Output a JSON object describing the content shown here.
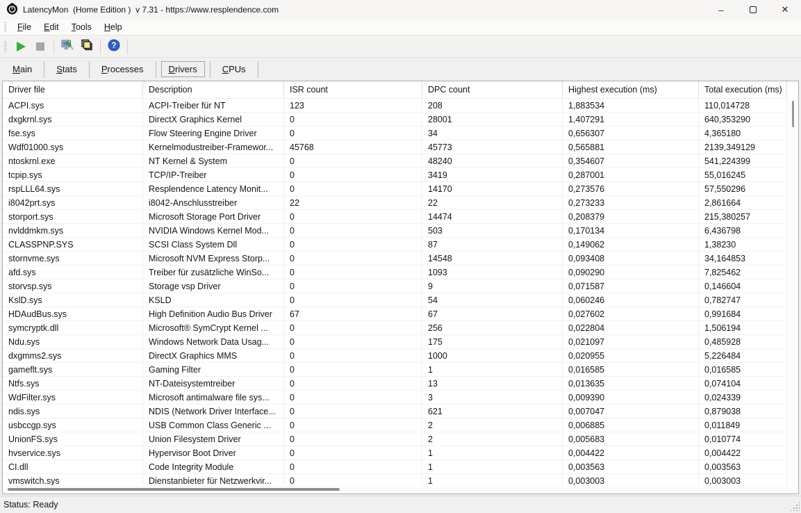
{
  "window": {
    "title": "LatencyMon  (Home Edition )  v 7.31 - https://www.resplendence.com",
    "app_icon": "stopwatch-logo-icon",
    "controls": {
      "minimize_glyph": "–",
      "maximize": "maximize-box",
      "close_glyph": "✕"
    }
  },
  "menu": {
    "items": [
      "File",
      "Edit",
      "Tools",
      "Help"
    ]
  },
  "toolbar": {
    "buttons": [
      {
        "name": "start-monitor",
        "icon": "play-icon"
      },
      {
        "name": "stop-monitor",
        "icon": "stop-icon"
      },
      {
        "name": "options",
        "icon": "options-screwdriver-monitor-icon"
      },
      {
        "name": "copy-report",
        "icon": "copy-report-squares-icon"
      },
      {
        "name": "help",
        "icon": "help-question-icon"
      }
    ]
  },
  "tabs": {
    "items": [
      "Main",
      "Stats",
      "Processes",
      "Drivers",
      "CPUs"
    ],
    "selected": "Drivers"
  },
  "table": {
    "columns": [
      "Driver file",
      "Description",
      "ISR count",
      "DPC count",
      "Highest execution (ms)",
      "Total execution (ms)"
    ],
    "column_keys": [
      "driver-file",
      "description",
      "isr-count",
      "dpc-count",
      "highest-execution-ms",
      "total-execution-ms"
    ],
    "rows": [
      [
        "ACPI.sys",
        "ACPI-Treiber für NT",
        "123",
        "208",
        "1,883534",
        "110,014728"
      ],
      [
        "dxgkrnl.sys",
        "DirectX Graphics Kernel",
        "0",
        "28001",
        "1,407291",
        "640,353290"
      ],
      [
        "fse.sys",
        "Flow Steering Engine Driver",
        "0",
        "34",
        "0,656307",
        "4,365180"
      ],
      [
        "Wdf01000.sys",
        "Kernelmodustreiber-Framewor...",
        "45768",
        "45773",
        "0,565881",
        "2139,349129"
      ],
      [
        "ntoskrnl.exe",
        "NT Kernel & System",
        "0",
        "48240",
        "0,354607",
        "541,224399"
      ],
      [
        "tcpip.sys",
        "TCP/IP-Treiber",
        "0",
        "3419",
        "0,287001",
        "55,016245"
      ],
      [
        "rspLLL64.sys",
        "Resplendence Latency Monit...",
        "0",
        "14170",
        "0,273576",
        "57,550296"
      ],
      [
        "i8042prt.sys",
        "i8042-Anschlusstreiber",
        "22",
        "22",
        "0,273233",
        "2,861664"
      ],
      [
        "storport.sys",
        "Microsoft Storage Port Driver",
        "0",
        "14474",
        "0,208379",
        "215,380257"
      ],
      [
        "nvlddmkm.sys",
        "NVIDIA Windows Kernel Mod...",
        "0",
        "503",
        "0,170134",
        "6,436798"
      ],
      [
        "CLASSPNP.SYS",
        "SCSI Class System Dll",
        "0",
        "87",
        "0,149062",
        "1,38230"
      ],
      [
        "stornvme.sys",
        "Microsoft NVM Express Storp...",
        "0",
        "14548",
        "0,093408",
        "34,164853"
      ],
      [
        "afd.sys",
        "Treiber für zusätzliche WinSo...",
        "0",
        "1093",
        "0,090290",
        "7,825462"
      ],
      [
        "storvsp.sys",
        "Storage vsp Driver",
        "0",
        "9",
        "0,071587",
        "0,146604"
      ],
      [
        "KslD.sys",
        "KSLD",
        "0",
        "54",
        "0,060246",
        "0,782747"
      ],
      [
        "HDAudBus.sys",
        "High Definition Audio Bus Driver",
        "67",
        "67",
        "0,027602",
        "0,991684"
      ],
      [
        "symcryptk.dll",
        "Microsoft® SymCrypt Kernel ...",
        "0",
        "256",
        "0,022804",
        "1,506194"
      ],
      [
        "Ndu.sys",
        "Windows Network Data Usag...",
        "0",
        "175",
        "0,021097",
        "0,485928"
      ],
      [
        "dxgmms2.sys",
        "DirectX Graphics MMS",
        "0",
        "1000",
        "0,020955",
        "5,226484"
      ],
      [
        "gameflt.sys",
        "Gaming Filter",
        "0",
        "1",
        "0,016585",
        "0,016585"
      ],
      [
        "Ntfs.sys",
        "NT-Dateisystemtreiber",
        "0",
        "13",
        "0,013635",
        "0,074104"
      ],
      [
        "WdFilter.sys",
        "Microsoft antimalware file sys...",
        "0",
        "3",
        "0,009390",
        "0,024339"
      ],
      [
        "ndis.sys",
        "NDIS (Network Driver Interface...",
        "0",
        "621",
        "0,007047",
        "0,879038"
      ],
      [
        "usbccgp.sys",
        "USB Common Class Generic ...",
        "0",
        "2",
        "0,006885",
        "0,011849"
      ],
      [
        "UnionFS.sys",
        "Union Filesystem Driver",
        "0",
        "2",
        "0,005683",
        "0,010774"
      ],
      [
        "hvservice.sys",
        "Hypervisor Boot Driver",
        "0",
        "1",
        "0,004422",
        "0,004422"
      ],
      [
        "CI.dll",
        "Code Integrity Module",
        "0",
        "1",
        "0,003563",
        "0,003563"
      ],
      [
        "vmswitch.sys",
        "Dienstanbieter für Netzwerkvir...",
        "0",
        "1",
        "0,003003",
        "0,003003"
      ]
    ]
  },
  "statusbar": {
    "text": "Status: Ready"
  },
  "colors": {
    "titlebar_bg": "#f8f6f5",
    "window_bg": "#f0f0f0",
    "table_bg": "#ffffff",
    "play_green": "#2eb33c",
    "stop_gray": "#a8a8a8",
    "help_blue": "#2f62c8",
    "report_yellow": "#f3ed8a"
  }
}
